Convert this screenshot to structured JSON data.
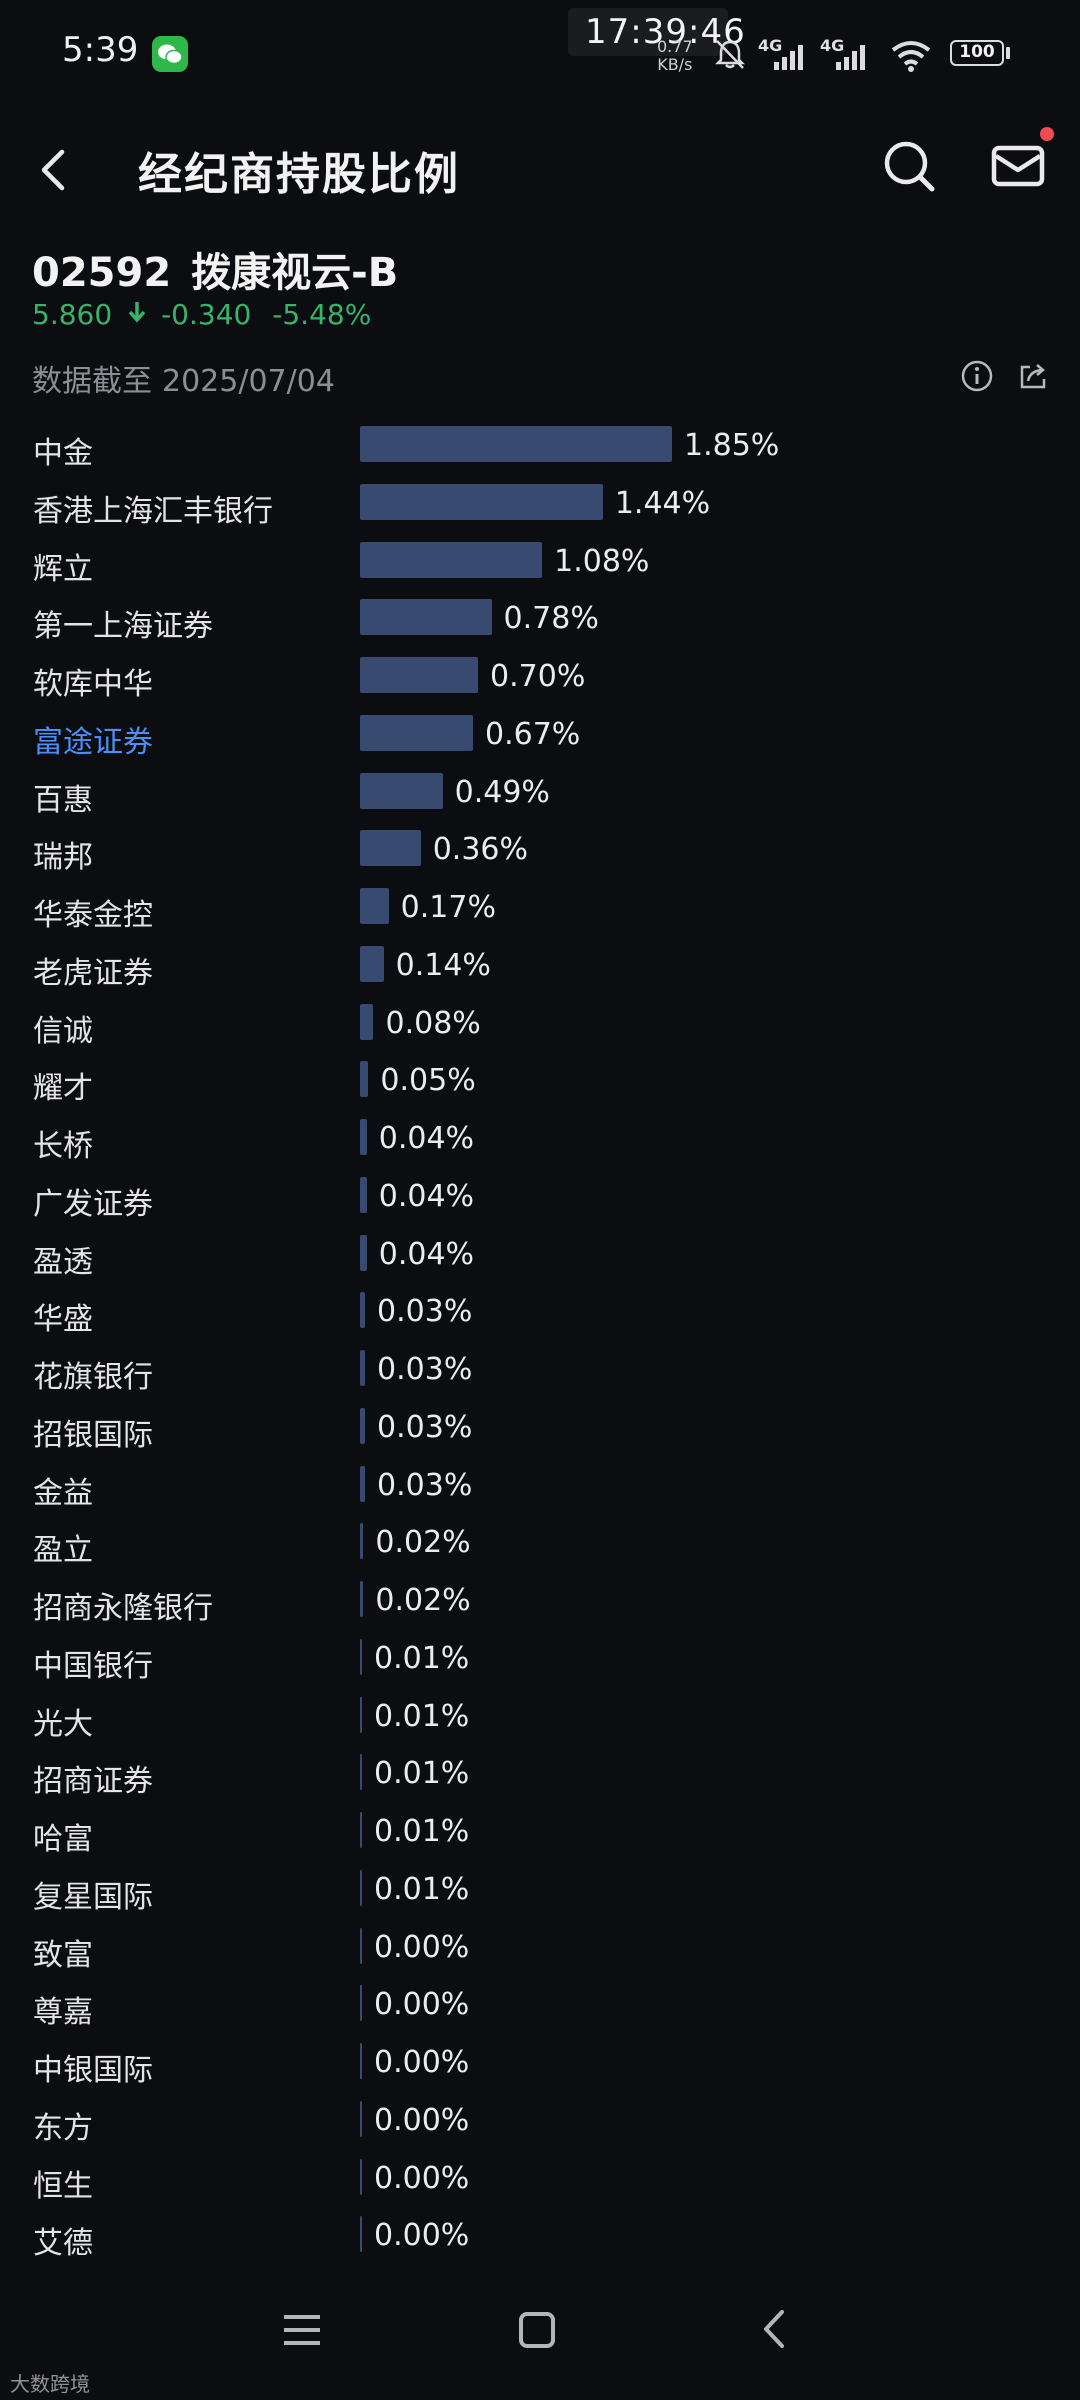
{
  "status_bar": {
    "time": "5:39",
    "clock_overlay": "17:39:46",
    "net_speed_value": "0.77",
    "net_speed_unit": "KB/s",
    "signal_1": "4G",
    "signal_2": "4G",
    "battery": "100",
    "icons": [
      "wechat-icon",
      "mute-bell-icon",
      "signal-icon",
      "wifi-icon",
      "battery-icon"
    ]
  },
  "nav": {
    "title": "经纪商持股比例",
    "icons": [
      "back-arrow-icon",
      "search-icon",
      "mail-icon"
    ]
  },
  "stock": {
    "code": "02592",
    "name": "拨康视云-B",
    "price": "5.860",
    "change": "-0.340",
    "change_pct": "-5.48%",
    "trend_color": "#37b36a"
  },
  "data_date": {
    "label": "数据截至",
    "date": "2025/07/04"
  },
  "colors": {
    "bar": "#394a70",
    "highlight": "#4c8df6",
    "background": "#0c0d10"
  },
  "brokers": [
    {
      "name": "中金",
      "pct": "1.85%",
      "value": 1.85
    },
    {
      "name": "香港上海汇丰银行",
      "pct": "1.44%",
      "value": 1.44
    },
    {
      "name": "辉立",
      "pct": "1.08%",
      "value": 1.08
    },
    {
      "name": "第一上海证券",
      "pct": "0.78%",
      "value": 0.78
    },
    {
      "name": "软库中华",
      "pct": "0.70%",
      "value": 0.7
    },
    {
      "name": "富途证券",
      "pct": "0.67%",
      "value": 0.67,
      "highlight": true
    },
    {
      "name": "百惠",
      "pct": "0.49%",
      "value": 0.49
    },
    {
      "name": "瑞邦",
      "pct": "0.36%",
      "value": 0.36
    },
    {
      "name": "华泰金控",
      "pct": "0.17%",
      "value": 0.17
    },
    {
      "name": "老虎证券",
      "pct": "0.14%",
      "value": 0.14
    },
    {
      "name": "信诚",
      "pct": "0.08%",
      "value": 0.08
    },
    {
      "name": "耀才",
      "pct": "0.05%",
      "value": 0.05
    },
    {
      "name": "长桥",
      "pct": "0.04%",
      "value": 0.04
    },
    {
      "name": "广发证券",
      "pct": "0.04%",
      "value": 0.04
    },
    {
      "name": "盈透",
      "pct": "0.04%",
      "value": 0.04
    },
    {
      "name": "华盛",
      "pct": "0.03%",
      "value": 0.03
    },
    {
      "name": "花旗银行",
      "pct": "0.03%",
      "value": 0.03
    },
    {
      "name": "招银国际",
      "pct": "0.03%",
      "value": 0.03
    },
    {
      "name": "金益",
      "pct": "0.03%",
      "value": 0.03
    },
    {
      "name": "盈立",
      "pct": "0.02%",
      "value": 0.02
    },
    {
      "name": "招商永隆银行",
      "pct": "0.02%",
      "value": 0.02
    },
    {
      "name": "中国银行",
      "pct": "0.01%",
      "value": 0.01
    },
    {
      "name": "光大",
      "pct": "0.01%",
      "value": 0.01
    },
    {
      "name": "招商证券",
      "pct": "0.01%",
      "value": 0.01
    },
    {
      "name": "哈富",
      "pct": "0.01%",
      "value": 0.01
    },
    {
      "name": "复星国际",
      "pct": "0.01%",
      "value": 0.01
    },
    {
      "name": "致富",
      "pct": "0.00%",
      "value": 0.0
    },
    {
      "name": "尊嘉",
      "pct": "0.00%",
      "value": 0.0
    },
    {
      "name": "中银国际",
      "pct": "0.00%",
      "value": 0.0
    },
    {
      "name": "东方",
      "pct": "0.00%",
      "value": 0.0
    },
    {
      "name": "恒生",
      "pct": "0.00%",
      "value": 0.0
    },
    {
      "name": "艾德",
      "pct": "0.00%",
      "value": 0.0
    }
  ],
  "bottom_nav": {
    "icons": [
      "menu-icon",
      "home-square-icon",
      "back-triangle-icon"
    ]
  },
  "watermark": "大数跨境"
}
